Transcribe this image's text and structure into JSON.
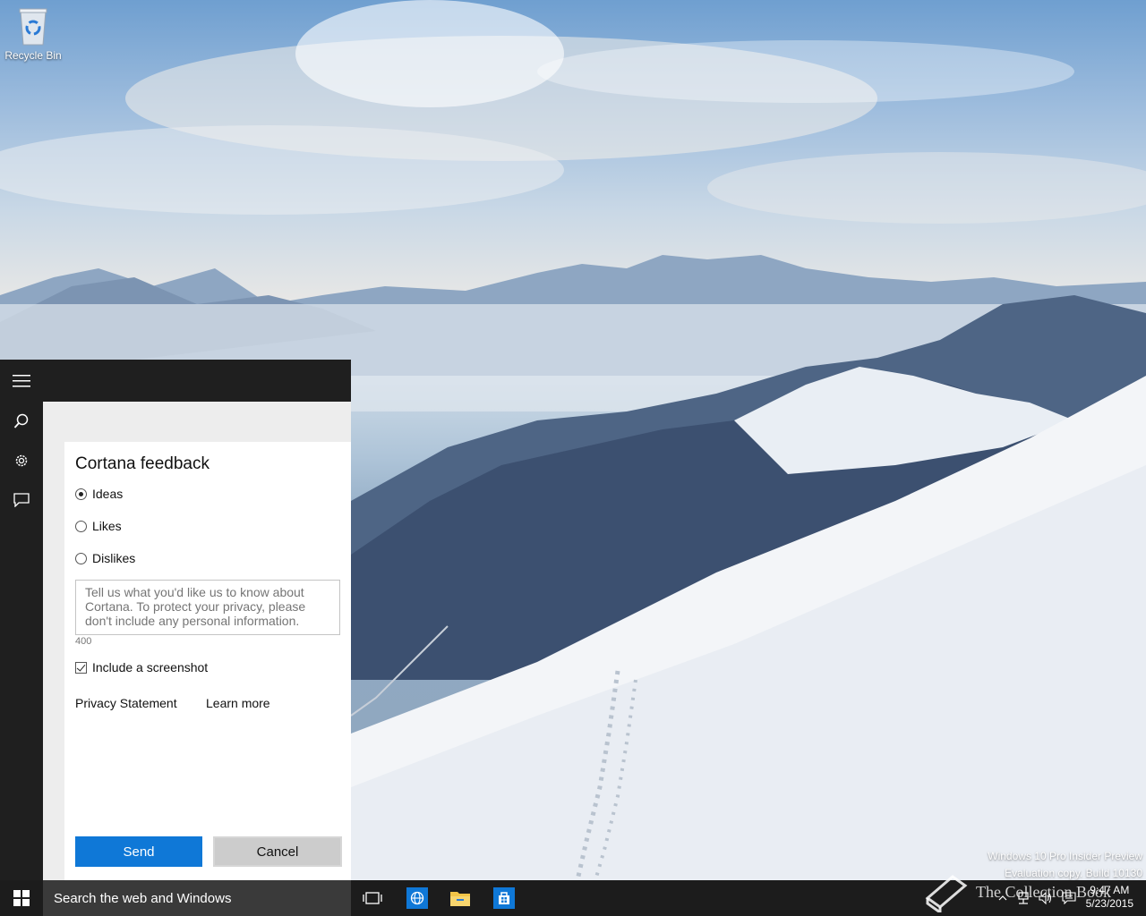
{
  "desktop": {
    "recycle_bin_label": "Recycle Bin",
    "watermark": {
      "line1": "Windows 10 Pro Insider Preview",
      "line2": "Evaluation copy. Build 10130"
    },
    "overlay_logo_text": "The Collection Book"
  },
  "cortana": {
    "rail_icons": [
      "hamburger-icon",
      "search-icon",
      "gear-icon",
      "feedback-icon"
    ],
    "card": {
      "title": "Cortana feedback",
      "options": [
        {
          "label": "Ideas",
          "selected": true
        },
        {
          "label": "Likes",
          "selected": false
        },
        {
          "label": "Dislikes",
          "selected": false
        }
      ],
      "feedback_placeholder": "Tell us what you'd like us to know about Cortana. To protect your privacy, please don't include any personal information.",
      "char_count": "400",
      "include_screenshot_label": "Include a screenshot",
      "include_screenshot_checked": true,
      "privacy_link": "Privacy Statement",
      "learn_more_link": "Learn more",
      "send_label": "Send",
      "cancel_label": "Cancel"
    }
  },
  "taskbar": {
    "search_text": "Search the web and Windows",
    "pinned": [
      "task-view-icon",
      "edge-browser-icon",
      "file-explorer-icon",
      "store-icon"
    ],
    "clock_time": "9:47 AM",
    "clock_date": "5/23/2015"
  },
  "colors": {
    "accent": "#0f78d7",
    "panel_dark": "#1f1f1f",
    "taskbar": "#1c1c1c",
    "search_bg": "#3a3a3a"
  }
}
